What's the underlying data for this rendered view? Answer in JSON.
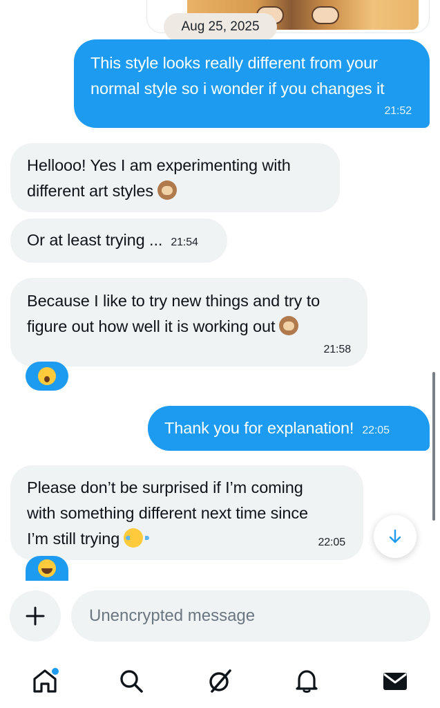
{
  "conversation": {
    "date_separator": "Aug 25, 2025",
    "messages": [
      {
        "direction": "outgoing",
        "lines": [
          "This style looks really different from your",
          "normal style so i wonder if you changes it"
        ],
        "time": "21:52"
      },
      {
        "direction": "incoming",
        "lines": [
          "Hellooo! Yes I am experimenting with",
          "different art styles"
        ],
        "emoji": "see-no-evil-monkey-icon"
      },
      {
        "direction": "incoming",
        "lines": [
          "Or at least trying ..."
        ],
        "time": "21:54"
      },
      {
        "direction": "incoming",
        "lines": [
          "Because I like to try new things and try to",
          "figure out how well it is working out"
        ],
        "emoji": "see-no-evil-monkey-icon",
        "time": "21:58",
        "reaction": "surprised-face-icon"
      },
      {
        "direction": "outgoing",
        "lines": [
          "Thank you for explanation!"
        ],
        "time": "22:05"
      },
      {
        "direction": "incoming",
        "lines": [
          "Please don’t be surprised if I’m coming",
          "with something different next time since",
          "I’m still trying"
        ],
        "emoji": "loudly-crying-face-icon",
        "time": "22:05",
        "reaction": "tears-of-joy-face-icon"
      }
    ]
  },
  "composer": {
    "placeholder": "Unencrypted message",
    "add_icon": "plus-icon"
  },
  "scroll_down_icon": "arrow-down-icon",
  "tabbar": {
    "items": [
      {
        "icon": "home-icon",
        "has_notification_dot": true
      },
      {
        "icon": "search-icon"
      },
      {
        "icon": "grok-icon"
      },
      {
        "icon": "bell-icon"
      },
      {
        "icon": "mail-icon",
        "active": true
      }
    ]
  },
  "colors": {
    "outgoing_bubble": "#1d9bf0",
    "incoming_bubble": "#eff3f4",
    "accent": "#1d9bf0",
    "date_pill": "#efe9e3"
  }
}
